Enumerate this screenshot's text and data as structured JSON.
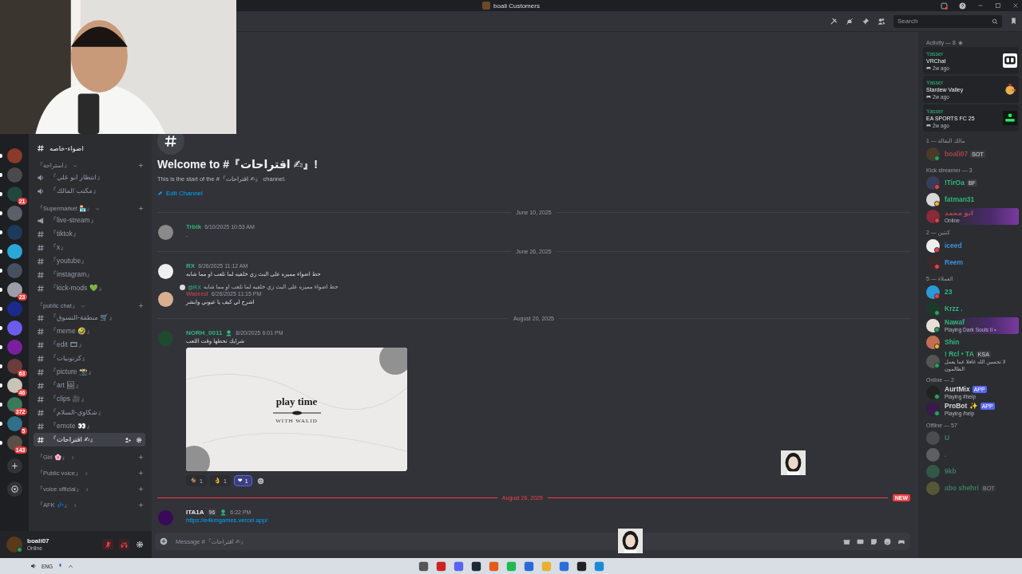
{
  "window": {
    "title": "boali Customers"
  },
  "header": {
    "search_placeholder": "Search"
  },
  "servers": [
    {
      "unread": true
    },
    {
      "unread": true
    },
    {
      "badge": "21",
      "unread": true
    },
    {
      "unread": true
    },
    {
      "unread": true
    },
    {
      "unread": true
    },
    {
      "unread": true
    },
    {
      "badge": "23",
      "unread": true
    },
    {
      "unread": true
    },
    {
      "unread": true
    },
    {
      "unread": true
    },
    {
      "badge": "63",
      "unread": true
    },
    {
      "badge": "46",
      "unread": true
    },
    {
      "badge": "372",
      "unread": true
    },
    {
      "badge": "5",
      "unread": true
    },
    {
      "badge": "143",
      "unread": true
    }
  ],
  "channels": [
    {
      "kind": "text",
      "name": "اضواء-خاصه",
      "selected": false,
      "unread": true
    },
    {
      "kind": "category",
      "name": "『استراحة』",
      "expanded": true,
      "children": [
        {
          "kind": "voice",
          "name": "『انتظار ابو علي』",
          "selected": false,
          "unread": false
        },
        {
          "kind": "voice",
          "name": "『مكتب المالك』",
          "selected": false,
          "unread": false
        }
      ]
    },
    {
      "kind": "category",
      "name": "『Supermarket 🏪』",
      "expanded": true,
      "children": [
        {
          "kind": "announce",
          "name": "『live-stream』",
          "selected": false,
          "unread": false
        },
        {
          "kind": "text",
          "name": "『tiktok』",
          "selected": false,
          "unread": false
        },
        {
          "kind": "text",
          "name": "『x』",
          "selected": false,
          "unread": false
        },
        {
          "kind": "text",
          "name": "『youtube』",
          "selected": false,
          "unread": false
        },
        {
          "kind": "text",
          "name": "『instagram』",
          "selected": false,
          "unread": false
        },
        {
          "kind": "text",
          "name": "『kick-mods 💚』",
          "selected": false,
          "unread": false
        }
      ]
    },
    {
      "kind": "category",
      "name": "『public chat』",
      "expanded": true,
      "children": [
        {
          "kind": "text",
          "name": "『منطقة-التسوق 🛒』",
          "selected": false,
          "unread": false
        },
        {
          "kind": "text",
          "name": "『meme 🤣』",
          "selected": false,
          "unread": false
        },
        {
          "kind": "text",
          "name": "『edit 🎞』",
          "selected": false,
          "unread": false
        },
        {
          "kind": "text",
          "name": "『كرتونيات』",
          "selected": false,
          "unread": false
        },
        {
          "kind": "text",
          "name": "『picture 📸』",
          "selected": false,
          "unread": false
        },
        {
          "kind": "text",
          "name": "『art 🖼』",
          "selected": false,
          "unread": false
        },
        {
          "kind": "text",
          "name": "『clips 🎥』",
          "selected": false,
          "unread": false
        },
        {
          "kind": "text",
          "name": "『شكاوي-السلام』",
          "selected": false,
          "unread": false
        },
        {
          "kind": "text",
          "name": "『emote 👀』",
          "selected": false,
          "unread": false
        },
        {
          "kind": "text",
          "name": "『اقتراحات ✍』",
          "selected": true,
          "unread": false
        }
      ]
    },
    {
      "kind": "category",
      "name": "『Girl 🌸』",
      "expanded": false
    },
    {
      "kind": "category",
      "name": "『Public voice』",
      "expanded": false
    },
    {
      "kind": "category",
      "name": "『voice official』",
      "expanded": false
    },
    {
      "kind": "category",
      "name": "『AFK 💤』",
      "expanded": false
    }
  ],
  "user": {
    "name": "boali07",
    "status": "Online",
    "muted": true,
    "deafened": true
  },
  "chat": {
    "welcome": {
      "title": "Welcome to #『اقتراحات ✍』!",
      "subtitle": "This is the start of the #『اقتراحات ✍』 channel.",
      "edit": "Edit Channel"
    },
    "items": [
      {
        "kind": "date",
        "text": "June 10, 2025",
        "new": false
      },
      {
        "kind": "message",
        "author": "Trblk",
        "color": "#2fb67c",
        "time": "6/10/2025 10:53 AM",
        "text": "."
      },
      {
        "kind": "date",
        "text": "June 26, 2025",
        "new": false
      },
      {
        "kind": "message",
        "author": "RX",
        "color": "#2fb67c",
        "time": "6/26/2025 11:12 AM",
        "text": "حط اضواء مميزه على البث زي خلفيه لما تلعب او مما شابه"
      },
      {
        "kind": "message",
        "author": "Waleed",
        "color": "#a8424c",
        "time": "6/26/2025 11:15 PM",
        "text": "اشرح لي كيف يا عيوني وابشر",
        "reply": {
          "mention": "@RX",
          "text": "حط اضواء مميزه على البث زي خلفيه لما تلعب او مما شابه"
        }
      },
      {
        "kind": "date",
        "text": "August 20, 2025",
        "new": false
      },
      {
        "kind": "message",
        "author": "NORH_0011",
        "color": "#2fb67c",
        "badge": true,
        "time": "8/20/2025 6:01 PM",
        "text": "شرايك تحطها وقت اللعب",
        "attachment": {
          "title": "play time",
          "subtitle": "WITH WALID"
        },
        "reactions": [
          {
            "emoji": "🐐",
            "count": "1",
            "selected": false
          },
          {
            "emoji": "👌",
            "count": "1",
            "selected": false
          },
          {
            "emoji": "❤",
            "count": "1",
            "selected": true
          }
        ]
      },
      {
        "kind": "date",
        "text": "August 26, 2025",
        "new": true,
        "badge": "NEW"
      },
      {
        "kind": "message",
        "author": "ITA1A",
        "color": "#e8e8ea",
        "tag": "96",
        "badge": true,
        "time": "6:22 PM",
        "link": "https://e4kmgames.vercel.app/"
      }
    ]
  },
  "composer": {
    "placeholder": "Message #『اقتراحات ✍』"
  },
  "members": {
    "activity": {
      "title": "Activity — 8",
      "cards": [
        {
          "user": "Yasser",
          "game": "VRChat",
          "time": "2w ago"
        },
        {
          "user": "Yasser",
          "game": "Stardew Valley",
          "time": "2w ago"
        },
        {
          "user": "Yasser",
          "game": "EA SPORTS FC 25",
          "time": "2w ago"
        }
      ]
    },
    "groups": [
      {
        "title": "مالك البقالة — 1",
        "members": [
          {
            "name": "boali07",
            "color": "#a8424c",
            "kind": "online",
            "tag": "SOT"
          }
        ]
      },
      {
        "title": "Kick streamer — 3",
        "members": [
          {
            "name": "!TirOa",
            "color": "#2fb67c",
            "kind": "dnd",
            "tag": "BF"
          },
          {
            "name": "fatman31",
            "color": "#2fb67c",
            "kind": "idle"
          },
          {
            "name": "ابو محمد",
            "color": "#b04850",
            "kind": "dnd",
            "status": "Online",
            "banner": true
          }
        ]
      },
      {
        "title": "كنتين — 2",
        "members": [
          {
            "name": "iceed",
            "color": "#3d8fd6",
            "kind": "dnd"
          },
          {
            "name": "Reem",
            "color": "#3d8fd6",
            "kind": "dnd"
          }
        ]
      },
      {
        "title": "العملاء — 5",
        "members": [
          {
            "name": "23",
            "color": "#2fb67c",
            "kind": "dnd"
          },
          {
            "name": "Krzz .",
            "color": "#2fb67c",
            "kind": "online"
          },
          {
            "name": "Nawaf",
            "color": "#2fb67c",
            "kind": "online",
            "status": "Playing Dark Souls II •",
            "banner": true
          },
          {
            "name": "Shin",
            "color": "#2fb67c",
            "kind": "idle"
          },
          {
            "name": "! Rcl • TA",
            "color": "#2fb67c",
            "kind": "online",
            "tag": "KSA",
            "status": "لا تحسبن الله غافلا عما يعمل الظالمون"
          }
        ]
      },
      {
        "title": "Online — 2",
        "members": [
          {
            "name": "AurtMix",
            "color": "#d8d9dc",
            "kind": "online",
            "tag": "APP",
            "app": true,
            "status": "Playing #help"
          },
          {
            "name": "ProBot ✨",
            "color": "#d8d9dc",
            "kind": "online",
            "tag": "APP",
            "app": true,
            "status": "Playing /help"
          }
        ]
      },
      {
        "title": "Offline — 57",
        "members": [
          {
            "name": "U",
            "color": "#3e7a60",
            "kind": "offline"
          },
          {
            "name": ".",
            "kind": "offline"
          },
          {
            "name": "9kb",
            "color": "#3e7a60",
            "kind": "offline"
          },
          {
            "name": "abo shehri",
            "color": "#3e7a60",
            "kind": "offline",
            "tag": "BOT"
          }
        ]
      }
    ]
  },
  "taskbar": {
    "language": "ENG"
  }
}
